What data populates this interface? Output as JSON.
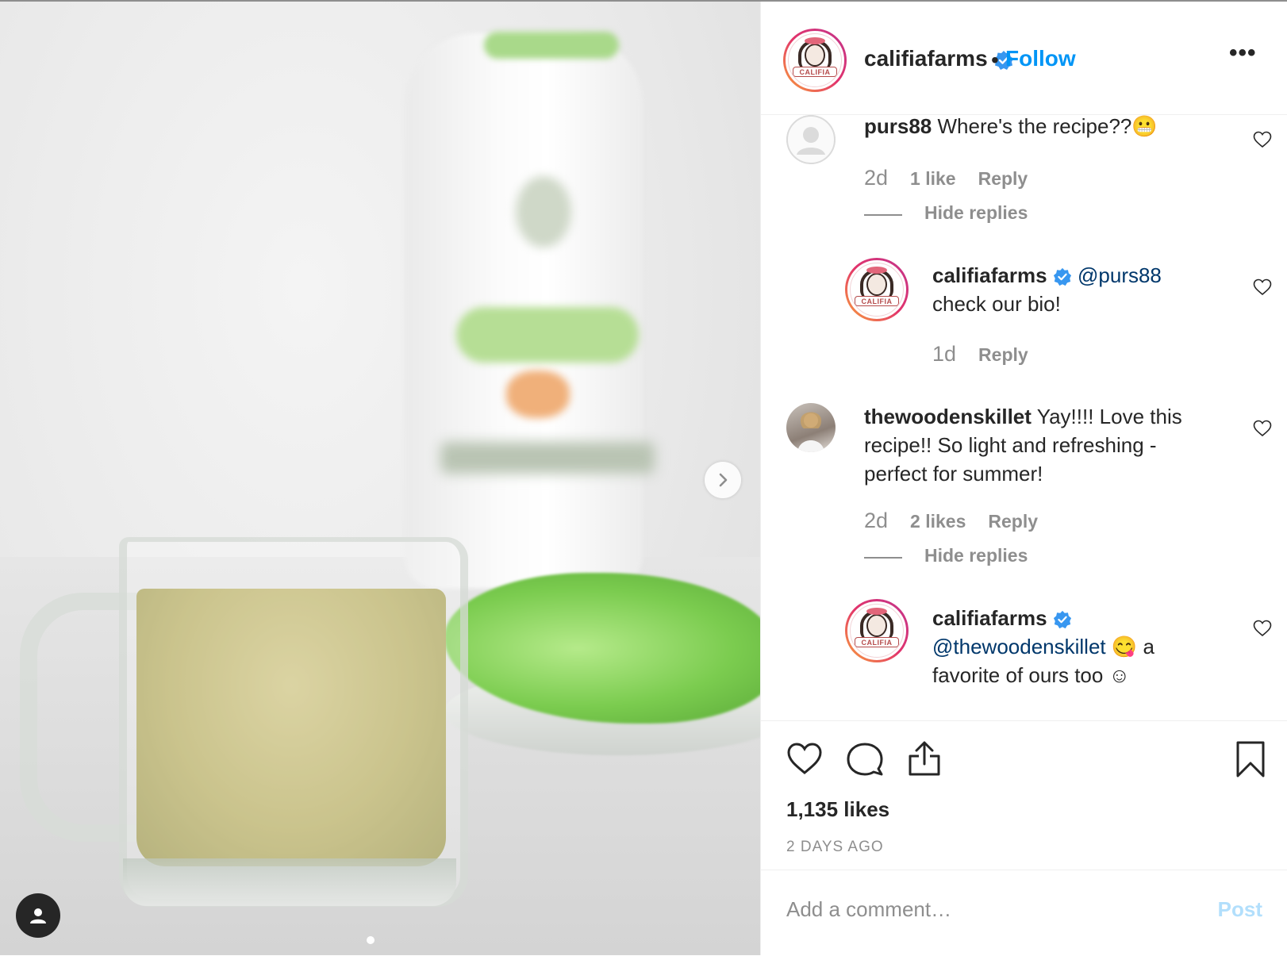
{
  "post": {
    "username": "califiafarms",
    "follow_label": "Follow",
    "separator": "•",
    "more_label": "•••"
  },
  "comments": [
    {
      "user": "purs88",
      "text": "Where's the recipe??😬",
      "time": "2d",
      "likes": "1 like",
      "reply": "Reply",
      "hide_replies": "Hide replies"
    },
    {
      "user": "califiafarms",
      "mention": "@purs88",
      "text": "check our bio!",
      "time": "1d",
      "reply": "Reply"
    },
    {
      "user": "thewoodenskillet",
      "text_line1": "Yay!!!! Love this",
      "text_line2": "recipe!! So light and refreshing -",
      "text_line3": "perfect for summer!",
      "time": "2d",
      "likes": "2 likes",
      "reply": "Reply",
      "hide_replies": "Hide replies"
    },
    {
      "user": "califiafarms",
      "mention": "@thewoodenskillet",
      "emoji": "😋",
      "text_after": "a",
      "text_line2": "favorite of ours too ☺"
    }
  ],
  "stats": {
    "likes": "1,135 likes",
    "time_ago": "2 DAYS AGO"
  },
  "comment_box": {
    "placeholder": "Add a comment…",
    "post_label": "Post"
  },
  "logo_text": "CALIFIA",
  "colors": {
    "accent": "#0095f6",
    "text": "#262626",
    "muted": "#8e8e8e",
    "post_disabled": "#b2dffc",
    "mention": "#00376b"
  },
  "icons": [
    "verified-badge-icon",
    "heart-icon",
    "comment-icon",
    "share-icon",
    "bookmark-icon",
    "chevron-right-icon",
    "user-tag-icon",
    "more-icon"
  ]
}
